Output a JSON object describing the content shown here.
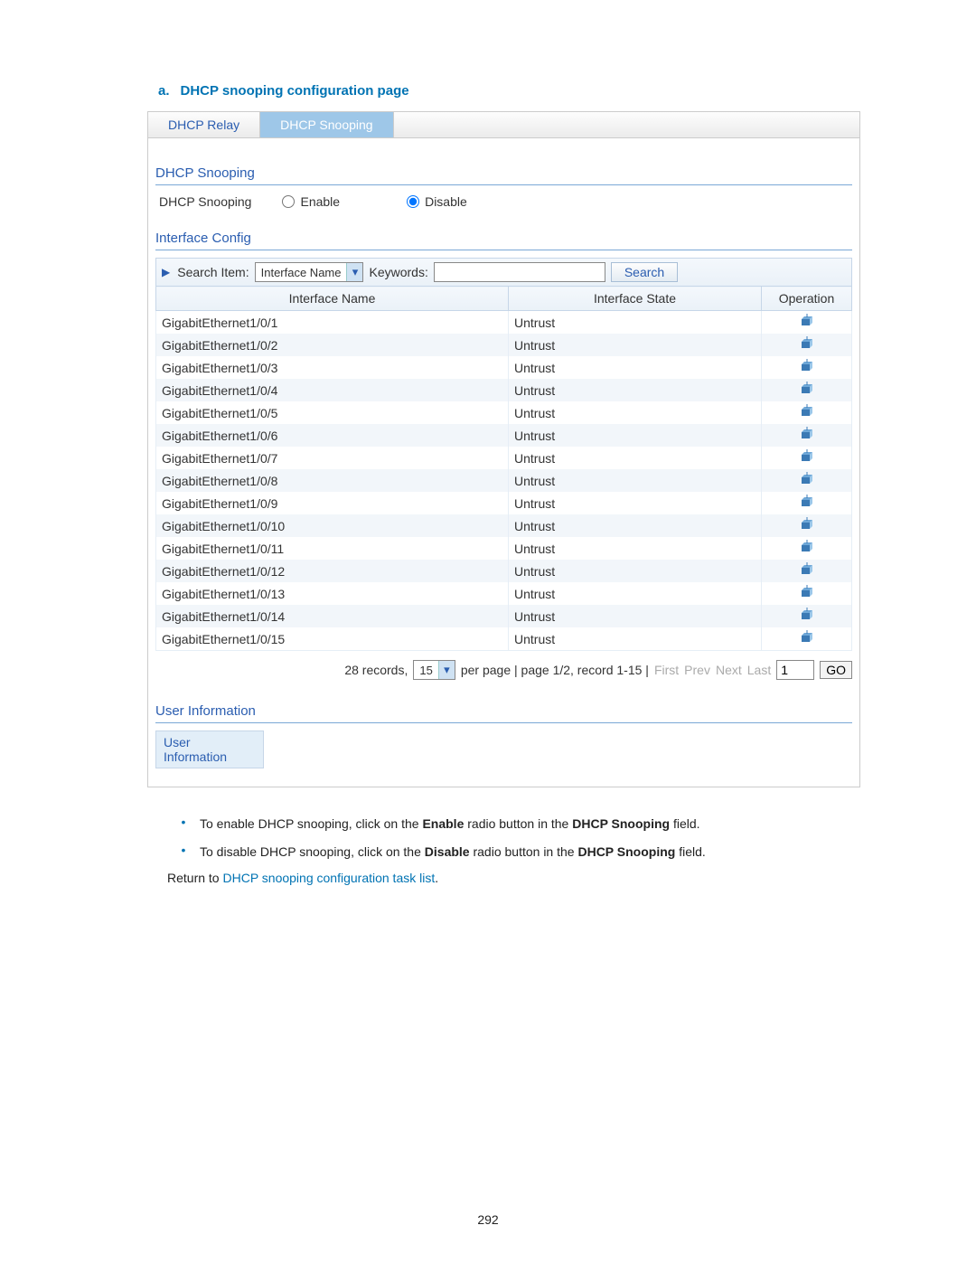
{
  "heading": {
    "prefix": "a.",
    "text": "DHCP snooping configuration page"
  },
  "tabs": [
    "DHCP Relay",
    "DHCP Snooping"
  ],
  "activeTab": 1,
  "section1": {
    "title": "DHCP Snooping",
    "fieldLabel": "DHCP Snooping",
    "opt1": "Enable",
    "opt2": "Disable",
    "selected": "Disable"
  },
  "section2": {
    "title": "Interface Config",
    "searchLabel": "Search Item:",
    "searchSelect": "Interface Name",
    "keywordsLabel": "Keywords:",
    "keywordsValue": "",
    "searchBtn": "Search",
    "columns": [
      "Interface Name",
      "Interface State",
      "Operation"
    ],
    "rows": [
      {
        "name": "GigabitEthernet1/0/1",
        "state": "Untrust"
      },
      {
        "name": "GigabitEthernet1/0/2",
        "state": "Untrust"
      },
      {
        "name": "GigabitEthernet1/0/3",
        "state": "Untrust"
      },
      {
        "name": "GigabitEthernet1/0/4",
        "state": "Untrust"
      },
      {
        "name": "GigabitEthernet1/0/5",
        "state": "Untrust"
      },
      {
        "name": "GigabitEthernet1/0/6",
        "state": "Untrust"
      },
      {
        "name": "GigabitEthernet1/0/7",
        "state": "Untrust"
      },
      {
        "name": "GigabitEthernet1/0/8",
        "state": "Untrust"
      },
      {
        "name": "GigabitEthernet1/0/9",
        "state": "Untrust"
      },
      {
        "name": "GigabitEthernet1/0/10",
        "state": "Untrust"
      },
      {
        "name": "GigabitEthernet1/0/11",
        "state": "Untrust"
      },
      {
        "name": "GigabitEthernet1/0/12",
        "state": "Untrust"
      },
      {
        "name": "GigabitEthernet1/0/13",
        "state": "Untrust"
      },
      {
        "name": "GigabitEthernet1/0/14",
        "state": "Untrust"
      },
      {
        "name": "GigabitEthernet1/0/15",
        "state": "Untrust"
      }
    ]
  },
  "pager": {
    "recordsPrefix": "28 records,",
    "perPage": "15",
    "perPageSuffix": "per page | page 1/2, record 1-15 |",
    "navFirst": "First",
    "navPrev": "Prev",
    "navNext": "Next",
    "navLast": "Last",
    "pageInput": "1",
    "goBtn": "GO"
  },
  "section3": {
    "title": "User Information",
    "box": "User Information"
  },
  "notes": {
    "b1_pre": "To enable DHCP snooping, click on the ",
    "b1_strong1": "Enable",
    "b1_mid": " radio button in the ",
    "b1_strong2": "DHCP Snooping",
    "b1_post": " field.",
    "b2_pre": "To disable DHCP snooping, click on the ",
    "b2_strong1": "Disable",
    "b2_mid": " radio button in the ",
    "b2_strong2": "DHCP Snooping",
    "b2_post": " field.",
    "returnPre": "Return to ",
    "returnLink": "DHCP snooping configuration task list",
    "returnPost": "."
  },
  "pageNumber": "292"
}
